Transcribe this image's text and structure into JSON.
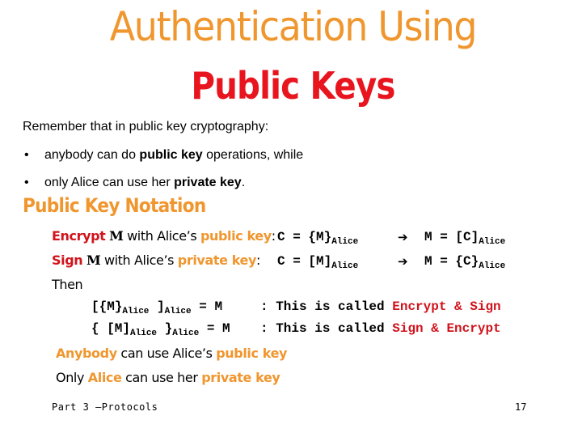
{
  "title": {
    "line1": "Authentication Using",
    "line2": "Public Keys",
    "line1_color": "#f0962e",
    "line2_color": "#e8141e"
  },
  "intro": "Remember that in public key cryptography:",
  "bullets": [
    {
      "symbol": "•",
      "pre": "anybody can do ",
      "bold": "public key",
      "post": " operations, while"
    },
    {
      "symbol": "•",
      "pre": "only Alice can use her ",
      "bold": "private key",
      "post": "."
    }
  ],
  "section_heading": "Public Key Notation",
  "notation": [
    {
      "verb": "Encrypt",
      "msg": "M",
      "mid": " with Alice’s ",
      "key": "public key",
      "colon": ":",
      "lhs": "C = {M}",
      "lhs_sub": "Alice",
      "arrow": "➔",
      "rhs": "M = [C]",
      "rhs_sub": "Alice"
    },
    {
      "verb": "Sign",
      "msg": "M",
      "mid": " with Alice’s ",
      "key": "private key",
      "colon": ":",
      "lhs": "C = [M]",
      "lhs_sub": "Alice",
      "arrow": "➔",
      "rhs": "M = {C}",
      "rhs_sub": "Alice"
    }
  ],
  "then_label": "Then",
  "compositions": [
    {
      "open": "[{M}",
      "sub1": "Alice",
      "close": " ]",
      "sub2": "Alice",
      "eq": " = M",
      "desc": ": This is called ",
      "name": "Encrypt & Sign"
    },
    {
      "open": "{ [M]",
      "sub1": "Alice",
      "close": " }",
      "sub2": "Alice",
      "eq": " = M",
      "desc": ": This is called ",
      "name": "Sign & Encrypt"
    }
  ],
  "summary": [
    {
      "a": "Anybody",
      "b": " can use Alice’s ",
      "c": "public key"
    },
    {
      "pre": "Only ",
      "a": "Alice",
      "b": " can use her ",
      "c": "private key"
    }
  ],
  "footer": {
    "left": "Part 3 —Protocols",
    "page_number": "17"
  }
}
